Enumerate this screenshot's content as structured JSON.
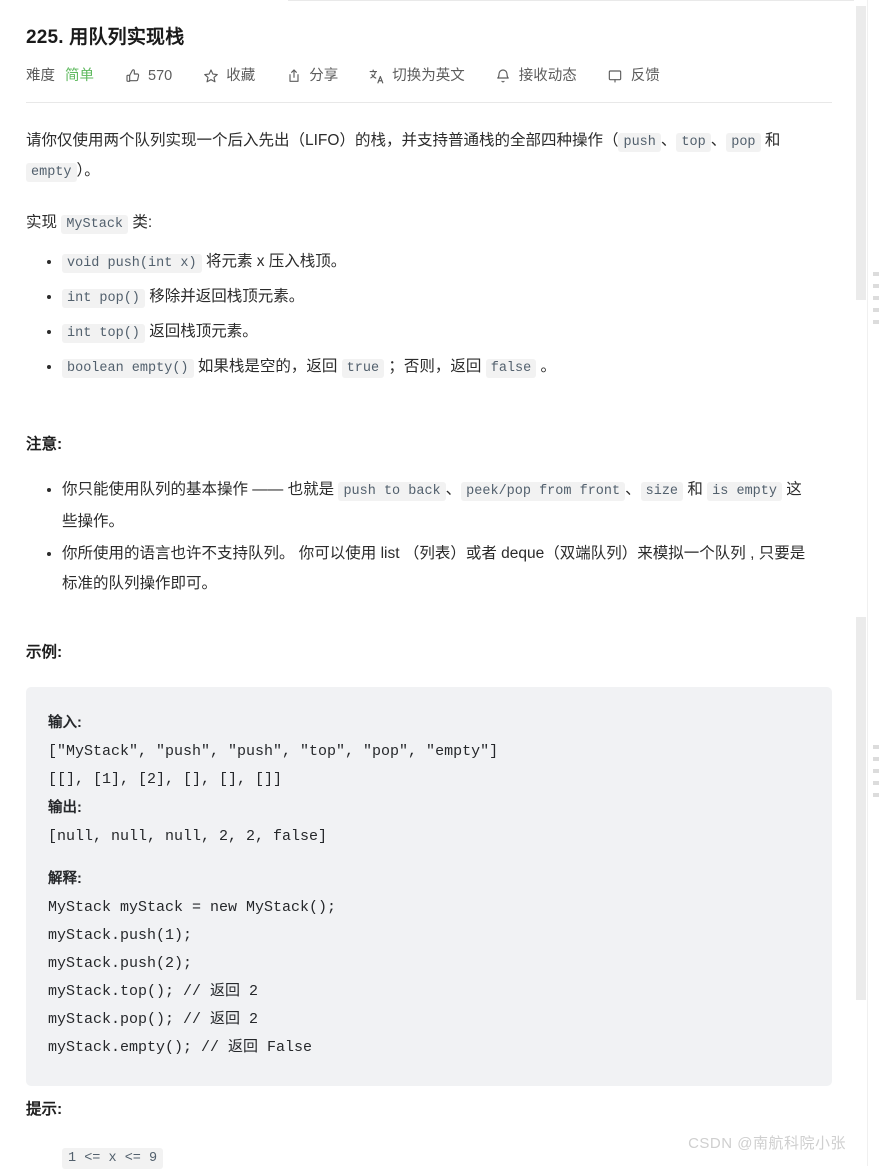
{
  "problem": {
    "title": "225. 用队列实现栈",
    "difficulty_label": "难度",
    "difficulty_value": "简单",
    "likes": "570"
  },
  "toolbar": {
    "favorite": "收藏",
    "share": "分享",
    "translate": "切换为英文",
    "subscribe": "接收动态",
    "feedback": "反馈",
    "icons": {
      "like": "thumbs-up-icon",
      "favorite": "star-icon",
      "share": "share-icon",
      "translate": "translate-icon",
      "subscribe": "bell-icon",
      "feedback": "comment-icon"
    }
  },
  "description": {
    "para1_a": "请你仅使用两个队列实现一个后入先出（LIFO）的栈，并支持普通栈的全部四种操作（",
    "code_push": "push",
    "sep1": "、",
    "code_top": "top",
    "sep2": "、",
    "code_pop": "pop",
    "and_word": "和",
    "code_empty": "empty",
    "para1_b": "）。",
    "para2_a": "实现",
    "code_mystack": "MyStack",
    "para2_b": "类:",
    "methods": [
      {
        "code": "void push(int x)",
        "text": "将元素 x 压入栈顶。"
      },
      {
        "code": "int pop()",
        "text": "移除并返回栈顶元素。"
      },
      {
        "code": "int top()",
        "text": "返回栈顶元素。"
      }
    ],
    "method_empty": {
      "code": "boolean empty()",
      "text_a": "如果栈是空的，返回",
      "code_true": "true",
      "text_b": "；否则，返回",
      "code_false": "false",
      "text_c": "。"
    }
  },
  "note": {
    "heading": "注意:",
    "item1_a": "你只能使用队列的基本操作 —— 也就是",
    "item1_code1": "push to back",
    "item1_sep1": "、",
    "item1_code2": "peek/pop from front",
    "item1_sep2": "、",
    "item1_code3": "size",
    "item1_and": "和",
    "item1_code4": "is empty",
    "item1_b": "这些操作。",
    "item2": "你所使用的语言也许不支持队列。 你可以使用 list （列表）或者 deque（双端队列）来模拟一个队列 , 只要是标准的队列操作即可。"
  },
  "example": {
    "heading": "示例:",
    "input_label": "输入:",
    "input_line1": "[\"MyStack\", \"push\", \"push\", \"top\", \"pop\", \"empty\"]",
    "input_line2": "[[], [1], [2], [], [], []]",
    "output_label": "输出:",
    "output_line": "[null, null, null, 2, 2, false]",
    "explain_label": "解释:",
    "explain_lines": [
      "MyStack myStack = new MyStack();",
      "myStack.push(1);",
      "myStack.push(2);",
      "myStack.top(); // 返回 2",
      "myStack.pop(); // 返回 2",
      "myStack.empty(); // 返回 False"
    ]
  },
  "hints": {
    "heading": "提示:",
    "first_chip": "1 <= x <= 9"
  },
  "watermark": "CSDN @南航科院小张",
  "colors": {
    "difficulty_green": "#5eb95e",
    "code_chip_bg": "#f2f2f2",
    "example_bg": "#f1f2f4",
    "text": "#2b2b2b",
    "watermark": "#cfcfcf"
  }
}
